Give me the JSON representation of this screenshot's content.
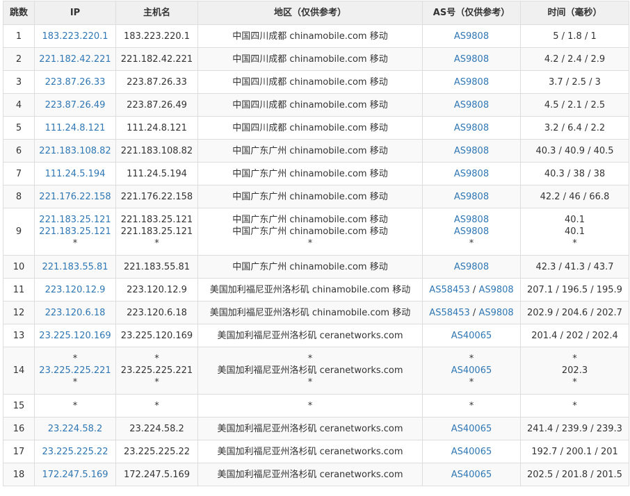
{
  "colors": {
    "link": "#2f77b4",
    "header_bg": "#f0f0f0",
    "border": "#dddddd",
    "text": "#333333"
  },
  "headers": [
    "跳数",
    "IP",
    "主机名",
    "地区（仅供参考）",
    "AS号（仅供参考）",
    "时间（毫秒）"
  ],
  "rows": [
    {
      "hop": "1",
      "ip": [
        "183.223.220.1"
      ],
      "host": [
        "183.223.220.1"
      ],
      "region": [
        "中国四川成都 chinamobile.com 移动"
      ],
      "as": [
        [
          "AS9808"
        ]
      ],
      "time": [
        "5 / 1.8 / 1"
      ]
    },
    {
      "hop": "2",
      "ip": [
        "221.182.42.221"
      ],
      "host": [
        "221.182.42.221"
      ],
      "region": [
        "中国四川成都 chinamobile.com 移动"
      ],
      "as": [
        [
          "AS9808"
        ]
      ],
      "time": [
        "4.2 / 2.4 / 2.9"
      ]
    },
    {
      "hop": "3",
      "ip": [
        "223.87.26.33"
      ],
      "host": [
        "223.87.26.33"
      ],
      "region": [
        "中国四川成都 chinamobile.com 移动"
      ],
      "as": [
        [
          "AS9808"
        ]
      ],
      "time": [
        "3.7 / 2.5 / 3"
      ]
    },
    {
      "hop": "4",
      "ip": [
        "223.87.26.49"
      ],
      "host": [
        "223.87.26.49"
      ],
      "region": [
        "中国四川成都 chinamobile.com 移动"
      ],
      "as": [
        [
          "AS9808"
        ]
      ],
      "time": [
        "4.5 / 2.1 / 2.5"
      ]
    },
    {
      "hop": "5",
      "ip": [
        "111.24.8.121"
      ],
      "host": [
        "111.24.8.121"
      ],
      "region": [
        "中国四川成都 chinamobile.com 移动"
      ],
      "as": [
        [
          "AS9808"
        ]
      ],
      "time": [
        "3.2 / 6.4 / 2.2"
      ]
    },
    {
      "hop": "6",
      "ip": [
        "221.183.108.82"
      ],
      "host": [
        "221.183.108.82"
      ],
      "region": [
        "中国广东广州 chinamobile.com 移动"
      ],
      "as": [
        [
          "AS9808"
        ]
      ],
      "time": [
        "40.3 / 40.9 / 40.5"
      ]
    },
    {
      "hop": "7",
      "ip": [
        "111.24.5.194"
      ],
      "host": [
        "111.24.5.194"
      ],
      "region": [
        "中国广东广州 chinamobile.com 移动"
      ],
      "as": [
        [
          "AS9808"
        ]
      ],
      "time": [
        "40.3 / 38 / 38"
      ]
    },
    {
      "hop": "8",
      "ip": [
        "221.176.22.158"
      ],
      "host": [
        "221.176.22.158"
      ],
      "region": [
        "中国广东广州 chinamobile.com 移动"
      ],
      "as": [
        [
          "AS9808"
        ]
      ],
      "time": [
        "42.2 / 46 / 66.8"
      ]
    },
    {
      "hop": "9",
      "ip": [
        "221.183.25.121",
        "221.183.25.121",
        "*"
      ],
      "host": [
        "221.183.25.121",
        "221.183.25.121",
        "*"
      ],
      "region": [
        "中国广东广州 chinamobile.com 移动",
        "中国广东广州 chinamobile.com 移动",
        "*"
      ],
      "as": [
        [
          "AS9808"
        ],
        [
          "AS9808"
        ],
        [
          "*"
        ]
      ],
      "time": [
        "40.1",
        "40.1",
        "*"
      ]
    },
    {
      "hop": "10",
      "ip": [
        "221.183.55.81"
      ],
      "host": [
        "221.183.55.81"
      ],
      "region": [
        "中国广东广州 chinamobile.com 移动"
      ],
      "as": [
        [
          "AS9808"
        ]
      ],
      "time": [
        "42.3 / 41.3 / 43.7"
      ]
    },
    {
      "hop": "11",
      "ip": [
        "223.120.12.9"
      ],
      "host": [
        "223.120.12.9"
      ],
      "region": [
        "美国加利福尼亚州洛杉矶 chinamobile.com 移动"
      ],
      "as": [
        [
          "AS58453",
          "AS9808"
        ]
      ],
      "time": [
        "207.1 / 196.5 / 195.9"
      ]
    },
    {
      "hop": "12",
      "ip": [
        "223.120.6.18"
      ],
      "host": [
        "223.120.6.18"
      ],
      "region": [
        "美国加利福尼亚州洛杉矶 chinamobile.com 移动"
      ],
      "as": [
        [
          "AS58453",
          "AS9808"
        ]
      ],
      "time": [
        "202.9 / 204.6 / 202.7"
      ]
    },
    {
      "hop": "13",
      "ip": [
        "23.225.120.169"
      ],
      "host": [
        "23.225.120.169"
      ],
      "region": [
        "美国加利福尼亚州洛杉矶 ceranetworks.com"
      ],
      "as": [
        [
          "AS40065"
        ]
      ],
      "time": [
        "201.4 / 202 / 202.4"
      ]
    },
    {
      "hop": "14",
      "ip": [
        "*",
        "23.225.225.221",
        "*"
      ],
      "host": [
        "*",
        "23.225.225.221",
        "*"
      ],
      "region": [
        "*",
        "美国加利福尼亚州洛杉矶 ceranetworks.com",
        "*"
      ],
      "as": [
        [
          "*"
        ],
        [
          "AS40065"
        ],
        [
          "*"
        ]
      ],
      "time": [
        "*",
        "202.3",
        "*"
      ]
    },
    {
      "hop": "15",
      "ip": [
        "*"
      ],
      "host": [
        "*"
      ],
      "region": [
        "*"
      ],
      "as": [
        [
          "*"
        ]
      ],
      "time": [
        "*"
      ]
    },
    {
      "hop": "16",
      "ip": [
        "23.224.58.2"
      ],
      "host": [
        "23.224.58.2"
      ],
      "region": [
        "美国加利福尼亚州洛杉矶 ceranetworks.com"
      ],
      "as": [
        [
          "AS40065"
        ]
      ],
      "time": [
        "241.4 / 239.9 / 239.3"
      ]
    },
    {
      "hop": "17",
      "ip": [
        "23.225.225.22"
      ],
      "host": [
        "23.225.225.22"
      ],
      "region": [
        "美国加利福尼亚州洛杉矶 ceranetworks.com"
      ],
      "as": [
        [
          "AS40065"
        ]
      ],
      "time": [
        "192.7 / 200.1 / 201"
      ]
    },
    {
      "hop": "18",
      "ip": [
        "172.247.5.169"
      ],
      "host": [
        "172.247.5.169"
      ],
      "region": [
        "美国加利福尼亚州洛杉矶 ceranetworks.com"
      ],
      "as": [
        [
          "AS40065"
        ]
      ],
      "time": [
        "202.5 / 201.8 / 201.5"
      ]
    }
  ]
}
